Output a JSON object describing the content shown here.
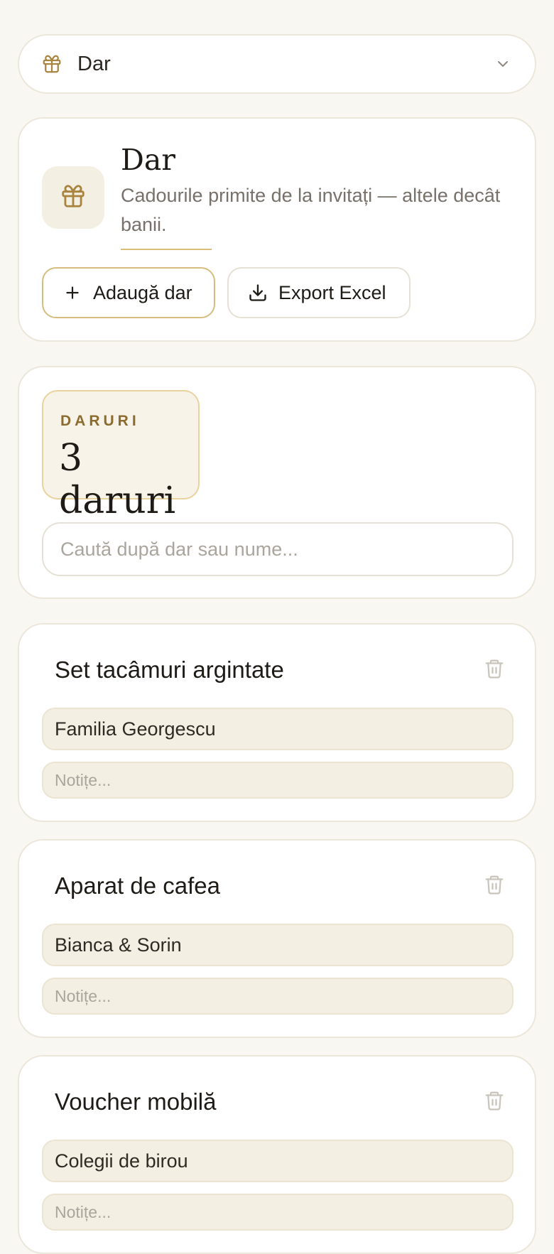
{
  "section_select": {
    "label": "Dar",
    "icon": "gift-icon"
  },
  "header": {
    "title": "Dar",
    "subtitle": "Cadourile primite de la invitați — altele decât banii.",
    "add_label": "Adaugă dar",
    "export_label": "Export Excel"
  },
  "stats": {
    "caption": "DARURI",
    "value": "3 daruri",
    "search_placeholder": "Caută după dar sau nume..."
  },
  "gifts": [
    {
      "title": "Set tacâmuri argintate",
      "giver": "Familia Georgescu",
      "notes_placeholder": "Notițe..."
    },
    {
      "title": "Aparat de cafea",
      "giver": "Bianca & Sorin",
      "notes_placeholder": "Notițe..."
    },
    {
      "title": "Voucher mobilă",
      "giver": "Colegii de birou",
      "notes_placeholder": "Notițe..."
    }
  ],
  "colors": {
    "accent": "#a8843f",
    "background": "#f9f7f1",
    "card_border": "#ece7db",
    "field_fill": "#f4efe3"
  }
}
